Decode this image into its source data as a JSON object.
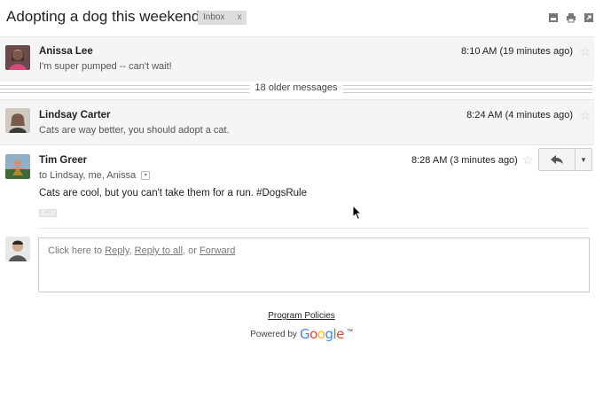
{
  "thread": {
    "subject": "Adopting a dog this weekend :)",
    "label": "Inbox",
    "label_remove": "x"
  },
  "toolbar": {
    "icons": [
      "archive-icon",
      "print-icon",
      "popout-icon"
    ]
  },
  "messages": [
    {
      "sender": "Anissa Lee",
      "date": "8:10 AM (19 minutes ago)",
      "snippet": "I'm super pumped -- can't wait!"
    },
    {
      "sender": "Lindsay Carter",
      "date": "8:24 AM (4 minutes ago)",
      "snippet": "Cats are way better, you should adopt a cat."
    },
    {
      "sender": "Tim Greer",
      "date": "8:28 AM (3 minutes ago)",
      "recipients": "to Lindsay, me, Anissa",
      "body": "Cats are cool, but you can't take them for a run. #DogsRule"
    }
  ],
  "older_messages": "18 older messages",
  "reply": {
    "prefix": "Click here to ",
    "reply": "Reply",
    "sep1": ", ",
    "reply_all": "Reply to all",
    "sep2": ", or ",
    "forward": "Forward"
  },
  "footer": {
    "policies": "Program Policies",
    "powered_by": "Powered by",
    "google": "Google",
    "tm": "™"
  },
  "colors": {
    "google_blue": "#4285f4",
    "google_red": "#ea4335",
    "google_yellow": "#fbbc05",
    "google_green": "#34a853"
  }
}
